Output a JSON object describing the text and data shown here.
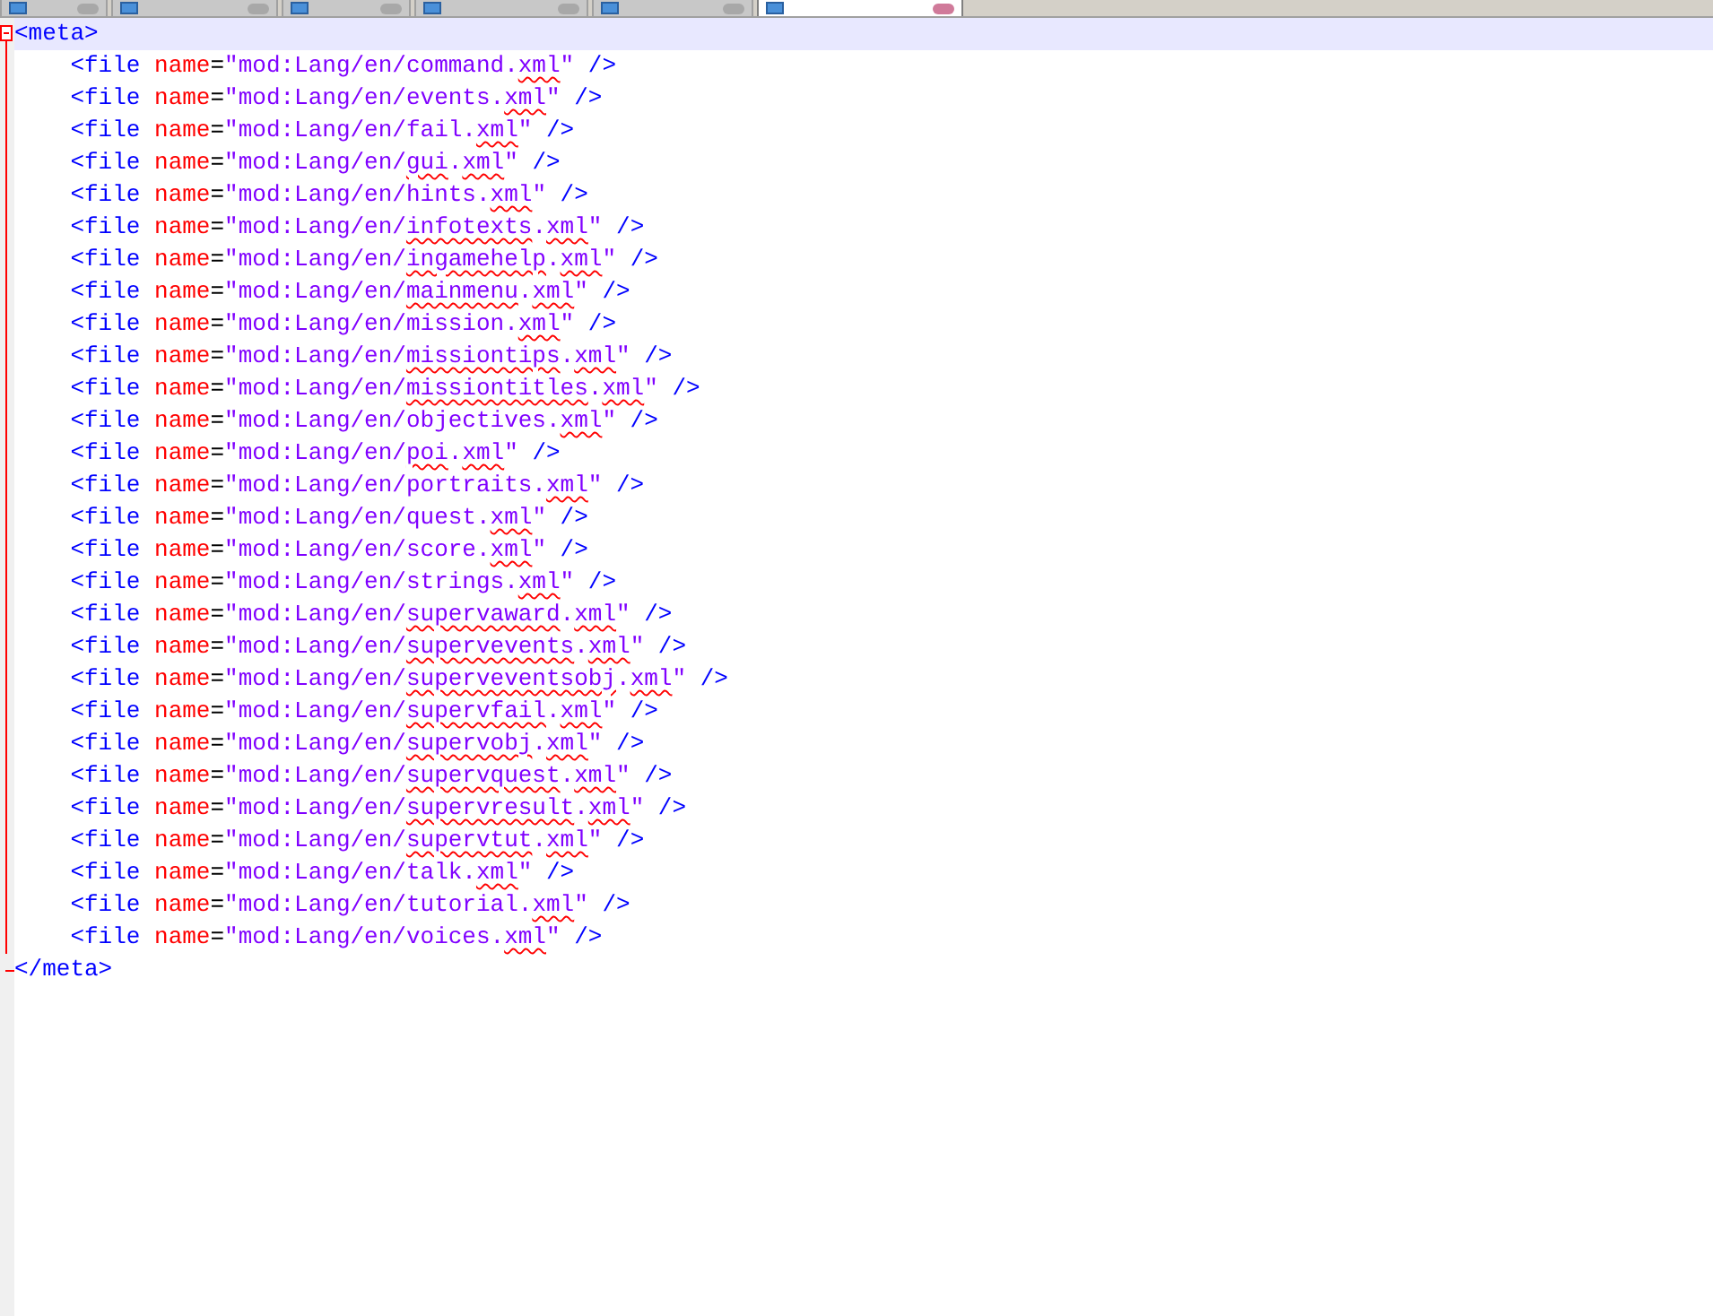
{
  "tabs": [
    {
      "selected": false
    },
    {
      "selected": false
    },
    {
      "selected": false
    },
    {
      "selected": false
    },
    {
      "selected": false
    },
    {
      "selected": true
    }
  ],
  "editor": {
    "open_tag": "<meta>",
    "close_tag": "</meta>",
    "lines": [
      [
        {
          "kind": "tag",
          "text": "<file"
        },
        {
          "kind": "attr",
          "text": "name"
        },
        {
          "kind": "eq",
          "text": "="
        },
        {
          "kind": "value",
          "text": "\"mod:Lang/en/command.",
          "flagged": false
        },
        {
          "kind": "value",
          "text": "xml",
          "flagged": true
        },
        {
          "kind": "value",
          "text": "\"",
          "flagged": false
        },
        {
          "kind": "end",
          "text": "/>"
        }
      ],
      [
        {
          "kind": "tag",
          "text": "<file"
        },
        {
          "kind": "attr",
          "text": "name"
        },
        {
          "kind": "eq",
          "text": "="
        },
        {
          "kind": "value",
          "text": "\"mod:Lang/en/events.",
          "flagged": false
        },
        {
          "kind": "value",
          "text": "xml",
          "flagged": true
        },
        {
          "kind": "value",
          "text": "\"",
          "flagged": false
        },
        {
          "kind": "end",
          "text": "/>"
        }
      ],
      [
        {
          "kind": "tag",
          "text": "<file"
        },
        {
          "kind": "attr",
          "text": "name"
        },
        {
          "kind": "eq",
          "text": "="
        },
        {
          "kind": "value",
          "text": "\"mod:Lang/en/fail.",
          "flagged": false
        },
        {
          "kind": "value",
          "text": "xml",
          "flagged": true
        },
        {
          "kind": "value",
          "text": "\"",
          "flagged": false
        },
        {
          "kind": "end",
          "text": "/>"
        }
      ],
      [
        {
          "kind": "tag",
          "text": "<file"
        },
        {
          "kind": "attr",
          "text": "name"
        },
        {
          "kind": "eq",
          "text": "="
        },
        {
          "kind": "value",
          "text": "\"mod:Lang/en/",
          "flagged": false
        },
        {
          "kind": "value",
          "text": "gui",
          "flagged": true
        },
        {
          "kind": "value",
          "text": ".",
          "flagged": false
        },
        {
          "kind": "value",
          "text": "xml",
          "flagged": true
        },
        {
          "kind": "value",
          "text": "\"",
          "flagged": false
        },
        {
          "kind": "end",
          "text": "/>"
        }
      ],
      [
        {
          "kind": "tag",
          "text": "<file"
        },
        {
          "kind": "attr",
          "text": "name"
        },
        {
          "kind": "eq",
          "text": "="
        },
        {
          "kind": "value",
          "text": "\"mod:Lang/en/hints.",
          "flagged": false
        },
        {
          "kind": "value",
          "text": "xml",
          "flagged": true
        },
        {
          "kind": "value",
          "text": "\"",
          "flagged": false
        },
        {
          "kind": "end",
          "text": "/>"
        }
      ],
      [
        {
          "kind": "tag",
          "text": "<file"
        },
        {
          "kind": "attr",
          "text": "name"
        },
        {
          "kind": "eq",
          "text": "="
        },
        {
          "kind": "value",
          "text": "\"mod:Lang/en/",
          "flagged": false
        },
        {
          "kind": "value",
          "text": "infotexts",
          "flagged": true
        },
        {
          "kind": "value",
          "text": ".",
          "flagged": false
        },
        {
          "kind": "value",
          "text": "xml",
          "flagged": true
        },
        {
          "kind": "value",
          "text": "\"",
          "flagged": false
        },
        {
          "kind": "end",
          "text": "/>"
        }
      ],
      [
        {
          "kind": "tag",
          "text": "<file"
        },
        {
          "kind": "attr",
          "text": "name"
        },
        {
          "kind": "eq",
          "text": "="
        },
        {
          "kind": "value",
          "text": "\"mod:Lang/en/",
          "flagged": false
        },
        {
          "kind": "value",
          "text": "ingamehelp",
          "flagged": true
        },
        {
          "kind": "value",
          "text": ".",
          "flagged": false
        },
        {
          "kind": "value",
          "text": "xml",
          "flagged": true
        },
        {
          "kind": "value",
          "text": "\"",
          "flagged": false
        },
        {
          "kind": "end",
          "text": "/>"
        }
      ],
      [
        {
          "kind": "tag",
          "text": "<file"
        },
        {
          "kind": "attr",
          "text": "name"
        },
        {
          "kind": "eq",
          "text": "="
        },
        {
          "kind": "value",
          "text": "\"mod:Lang/en/",
          "flagged": false
        },
        {
          "kind": "value",
          "text": "mainmenu",
          "flagged": true
        },
        {
          "kind": "value",
          "text": ".",
          "flagged": false
        },
        {
          "kind": "value",
          "text": "xml",
          "flagged": true
        },
        {
          "kind": "value",
          "text": "\"",
          "flagged": false
        },
        {
          "kind": "end",
          "text": "/>"
        }
      ],
      [
        {
          "kind": "tag",
          "text": "<file"
        },
        {
          "kind": "attr",
          "text": "name"
        },
        {
          "kind": "eq",
          "text": "="
        },
        {
          "kind": "value",
          "text": "\"mod:Lang/en/mission.",
          "flagged": false
        },
        {
          "kind": "value",
          "text": "xml",
          "flagged": true
        },
        {
          "kind": "value",
          "text": "\"",
          "flagged": false
        },
        {
          "kind": "end",
          "text": "/>"
        }
      ],
      [
        {
          "kind": "tag",
          "text": "<file"
        },
        {
          "kind": "attr",
          "text": "name"
        },
        {
          "kind": "eq",
          "text": "="
        },
        {
          "kind": "value",
          "text": "\"mod:Lang/en/",
          "flagged": false
        },
        {
          "kind": "value",
          "text": "missiontips",
          "flagged": true
        },
        {
          "kind": "value",
          "text": ".",
          "flagged": false
        },
        {
          "kind": "value",
          "text": "xml",
          "flagged": true
        },
        {
          "kind": "value",
          "text": "\"",
          "flagged": false
        },
        {
          "kind": "end",
          "text": "/>"
        }
      ],
      [
        {
          "kind": "tag",
          "text": "<file"
        },
        {
          "kind": "attr",
          "text": "name"
        },
        {
          "kind": "eq",
          "text": "="
        },
        {
          "kind": "value",
          "text": "\"mod:Lang/en/",
          "flagged": false
        },
        {
          "kind": "value",
          "text": "missiontitles",
          "flagged": true
        },
        {
          "kind": "value",
          "text": ".",
          "flagged": false
        },
        {
          "kind": "value",
          "text": "xml",
          "flagged": true
        },
        {
          "kind": "value",
          "text": "\"",
          "flagged": false
        },
        {
          "kind": "end",
          "text": "/>"
        }
      ],
      [
        {
          "kind": "tag",
          "text": "<file"
        },
        {
          "kind": "attr",
          "text": "name"
        },
        {
          "kind": "eq",
          "text": "="
        },
        {
          "kind": "value",
          "text": "\"mod:Lang/en/objectives.",
          "flagged": false
        },
        {
          "kind": "value",
          "text": "xml",
          "flagged": true
        },
        {
          "kind": "value",
          "text": "\"",
          "flagged": false
        },
        {
          "kind": "end",
          "text": "/>"
        }
      ],
      [
        {
          "kind": "tag",
          "text": "<file"
        },
        {
          "kind": "attr",
          "text": "name"
        },
        {
          "kind": "eq",
          "text": "="
        },
        {
          "kind": "value",
          "text": "\"mod:Lang/en/",
          "flagged": false
        },
        {
          "kind": "value",
          "text": "poi",
          "flagged": true
        },
        {
          "kind": "value",
          "text": ".",
          "flagged": false
        },
        {
          "kind": "value",
          "text": "xml",
          "flagged": true
        },
        {
          "kind": "value",
          "text": "\"",
          "flagged": false
        },
        {
          "kind": "end",
          "text": "/>"
        }
      ],
      [
        {
          "kind": "tag",
          "text": "<file"
        },
        {
          "kind": "attr",
          "text": "name"
        },
        {
          "kind": "eq",
          "text": "="
        },
        {
          "kind": "value",
          "text": "\"mod:Lang/en/portraits.",
          "flagged": false
        },
        {
          "kind": "value",
          "text": "xml",
          "flagged": true
        },
        {
          "kind": "value",
          "text": "\"",
          "flagged": false
        },
        {
          "kind": "end",
          "text": "/>"
        }
      ],
      [
        {
          "kind": "tag",
          "text": "<file"
        },
        {
          "kind": "attr",
          "text": "name"
        },
        {
          "kind": "eq",
          "text": "="
        },
        {
          "kind": "value",
          "text": "\"mod:Lang/en/quest.",
          "flagged": false
        },
        {
          "kind": "value",
          "text": "xml",
          "flagged": true
        },
        {
          "kind": "value",
          "text": "\"",
          "flagged": false
        },
        {
          "kind": "end",
          "text": "/>"
        }
      ],
      [
        {
          "kind": "tag",
          "text": "<file"
        },
        {
          "kind": "attr",
          "text": "name"
        },
        {
          "kind": "eq",
          "text": "="
        },
        {
          "kind": "value",
          "text": "\"mod:Lang/en/score.",
          "flagged": false
        },
        {
          "kind": "value",
          "text": "xml",
          "flagged": true
        },
        {
          "kind": "value",
          "text": "\"",
          "flagged": false
        },
        {
          "kind": "end",
          "text": "/>"
        }
      ],
      [
        {
          "kind": "tag",
          "text": "<file"
        },
        {
          "kind": "attr",
          "text": "name"
        },
        {
          "kind": "eq",
          "text": "="
        },
        {
          "kind": "value",
          "text": "\"mod:Lang/en/strings.",
          "flagged": false
        },
        {
          "kind": "value",
          "text": "xml",
          "flagged": true
        },
        {
          "kind": "value",
          "text": "\"",
          "flagged": false
        },
        {
          "kind": "end",
          "text": "/>"
        }
      ],
      [
        {
          "kind": "tag",
          "text": "<file"
        },
        {
          "kind": "attr",
          "text": "name"
        },
        {
          "kind": "eq",
          "text": "="
        },
        {
          "kind": "value",
          "text": "\"mod:Lang/en/",
          "flagged": false
        },
        {
          "kind": "value",
          "text": "supervaward",
          "flagged": true
        },
        {
          "kind": "value",
          "text": ".",
          "flagged": false
        },
        {
          "kind": "value",
          "text": "xml",
          "flagged": true
        },
        {
          "kind": "value",
          "text": "\"",
          "flagged": false
        },
        {
          "kind": "end",
          "text": "/>"
        }
      ],
      [
        {
          "kind": "tag",
          "text": "<file"
        },
        {
          "kind": "attr",
          "text": "name"
        },
        {
          "kind": "eq",
          "text": "="
        },
        {
          "kind": "value",
          "text": "\"mod:Lang/en/",
          "flagged": false
        },
        {
          "kind": "value",
          "text": "supervevents",
          "flagged": true
        },
        {
          "kind": "value",
          "text": ".",
          "flagged": false
        },
        {
          "kind": "value",
          "text": "xml",
          "flagged": true
        },
        {
          "kind": "value",
          "text": "\"",
          "flagged": false
        },
        {
          "kind": "end",
          "text": "/>"
        }
      ],
      [
        {
          "kind": "tag",
          "text": "<file"
        },
        {
          "kind": "attr",
          "text": "name"
        },
        {
          "kind": "eq",
          "text": "="
        },
        {
          "kind": "value",
          "text": "\"mod:Lang/en/",
          "flagged": false
        },
        {
          "kind": "value",
          "text": "superveventsobj",
          "flagged": true
        },
        {
          "kind": "value",
          "text": ".",
          "flagged": false
        },
        {
          "kind": "value",
          "text": "xml",
          "flagged": true
        },
        {
          "kind": "value",
          "text": "\"",
          "flagged": false
        },
        {
          "kind": "end",
          "text": "/>"
        }
      ],
      [
        {
          "kind": "tag",
          "text": "<file"
        },
        {
          "kind": "attr",
          "text": "name"
        },
        {
          "kind": "eq",
          "text": "="
        },
        {
          "kind": "value",
          "text": "\"mod:Lang/en/",
          "flagged": false
        },
        {
          "kind": "value",
          "text": "supervfail",
          "flagged": true
        },
        {
          "kind": "value",
          "text": ".",
          "flagged": false
        },
        {
          "kind": "value",
          "text": "xml",
          "flagged": true
        },
        {
          "kind": "value",
          "text": "\"",
          "flagged": false
        },
        {
          "kind": "end",
          "text": "/>"
        }
      ],
      [
        {
          "kind": "tag",
          "text": "<file"
        },
        {
          "kind": "attr",
          "text": "name"
        },
        {
          "kind": "eq",
          "text": "="
        },
        {
          "kind": "value",
          "text": "\"mod:Lang/en/",
          "flagged": false
        },
        {
          "kind": "value",
          "text": "supervobj",
          "flagged": true
        },
        {
          "kind": "value",
          "text": ".",
          "flagged": false
        },
        {
          "kind": "value",
          "text": "xml",
          "flagged": true
        },
        {
          "kind": "value",
          "text": "\"",
          "flagged": false
        },
        {
          "kind": "end",
          "text": "/>"
        }
      ],
      [
        {
          "kind": "tag",
          "text": "<file"
        },
        {
          "kind": "attr",
          "text": "name"
        },
        {
          "kind": "eq",
          "text": "="
        },
        {
          "kind": "value",
          "text": "\"mod:Lang/en/",
          "flagged": false
        },
        {
          "kind": "value",
          "text": "supervquest",
          "flagged": true
        },
        {
          "kind": "value",
          "text": ".",
          "flagged": false
        },
        {
          "kind": "value",
          "text": "xml",
          "flagged": true
        },
        {
          "kind": "value",
          "text": "\"",
          "flagged": false
        },
        {
          "kind": "end",
          "text": "/>"
        }
      ],
      [
        {
          "kind": "tag",
          "text": "<file"
        },
        {
          "kind": "attr",
          "text": "name"
        },
        {
          "kind": "eq",
          "text": "="
        },
        {
          "kind": "value",
          "text": "\"mod:Lang/en/",
          "flagged": false
        },
        {
          "kind": "value",
          "text": "supervresult",
          "flagged": true
        },
        {
          "kind": "value",
          "text": ".",
          "flagged": false
        },
        {
          "kind": "value",
          "text": "xml",
          "flagged": true
        },
        {
          "kind": "value",
          "text": "\"",
          "flagged": false
        },
        {
          "kind": "end",
          "text": "/>"
        }
      ],
      [
        {
          "kind": "tag",
          "text": "<file"
        },
        {
          "kind": "attr",
          "text": "name"
        },
        {
          "kind": "eq",
          "text": "="
        },
        {
          "kind": "value",
          "text": "\"mod:Lang/en/",
          "flagged": false
        },
        {
          "kind": "value",
          "text": "supervtut",
          "flagged": true
        },
        {
          "kind": "value",
          "text": ".",
          "flagged": false
        },
        {
          "kind": "value",
          "text": "xml",
          "flagged": true
        },
        {
          "kind": "value",
          "text": "\"",
          "flagged": false
        },
        {
          "kind": "end",
          "text": "/>"
        }
      ],
      [
        {
          "kind": "tag",
          "text": "<file"
        },
        {
          "kind": "attr",
          "text": "name"
        },
        {
          "kind": "eq",
          "text": "="
        },
        {
          "kind": "value",
          "text": "\"mod:Lang/en/talk.",
          "flagged": false
        },
        {
          "kind": "value",
          "text": "xml",
          "flagged": true
        },
        {
          "kind": "value",
          "text": "\"",
          "flagged": false
        },
        {
          "kind": "end",
          "text": "/>"
        }
      ],
      [
        {
          "kind": "tag",
          "text": "<file"
        },
        {
          "kind": "attr",
          "text": "name"
        },
        {
          "kind": "eq",
          "text": "="
        },
        {
          "kind": "value",
          "text": "\"mod:Lang/en/tutorial.",
          "flagged": false
        },
        {
          "kind": "value",
          "text": "xml",
          "flagged": true
        },
        {
          "kind": "value",
          "text": "\"",
          "flagged": false
        },
        {
          "kind": "end",
          "text": "/>"
        }
      ],
      [
        {
          "kind": "tag",
          "text": "<file"
        },
        {
          "kind": "attr",
          "text": "name"
        },
        {
          "kind": "eq",
          "text": "="
        },
        {
          "kind": "value",
          "text": "\"mod:Lang/en/voices.",
          "flagged": false
        },
        {
          "kind": "value",
          "text": "xml",
          "flagged": true
        },
        {
          "kind": "value",
          "text": "\"",
          "flagged": false
        },
        {
          "kind": "end",
          "text": "/>"
        }
      ]
    ]
  }
}
